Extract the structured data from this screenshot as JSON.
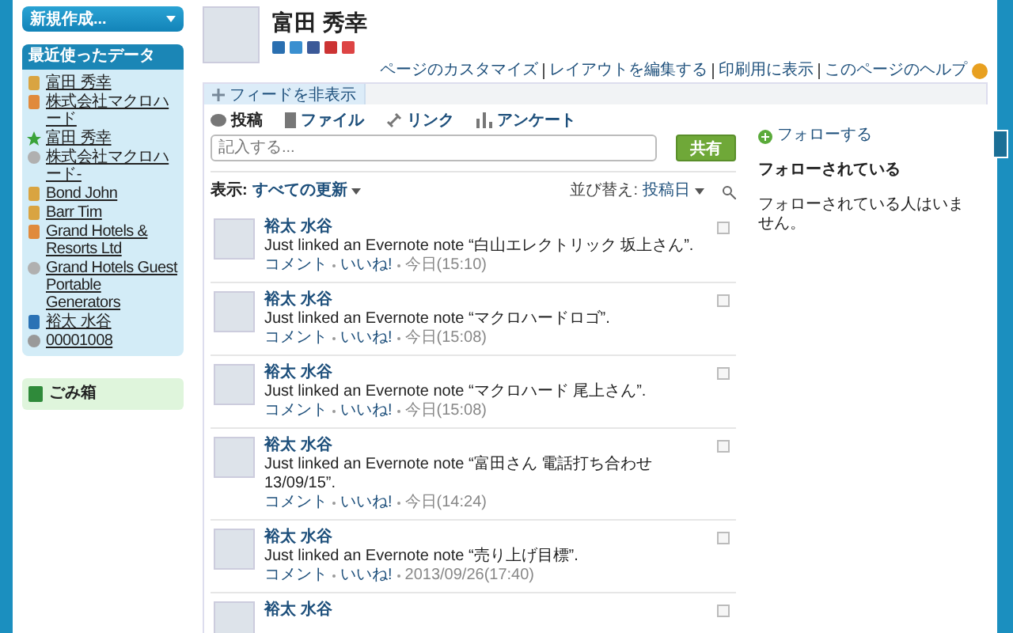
{
  "sidebar": {
    "create_button": "新規作成...",
    "recent": {
      "title": "最近使ったデータ",
      "items": [
        {
          "label": "富田 秀幸",
          "kind": "contact"
        },
        {
          "label": "株式会社マクロハード",
          "kind": "account"
        },
        {
          "label": "富田 秀幸",
          "kind": "lead"
        },
        {
          "label": "株式会社マクロハード-",
          "kind": "opportunity"
        },
        {
          "label": "Bond John",
          "kind": "contact"
        },
        {
          "label": "Barr Tim",
          "kind": "contact"
        },
        {
          "label": "Grand Hotels & Resorts Ltd",
          "kind": "account"
        },
        {
          "label": "Grand Hotels Guest Portable Generators",
          "kind": "opportunity"
        },
        {
          "label": "裕太 水谷",
          "kind": "user"
        },
        {
          "label": "00001008",
          "kind": "case"
        }
      ]
    },
    "trash": "ごみ箱"
  },
  "profile": {
    "name": "富田 秀幸"
  },
  "page_links": [
    "ページのカスタマイズ",
    "レイアウトを編集する",
    "印刷用に表示",
    "このページのヘルプ"
  ],
  "feed_toggle": "フィードを非表示",
  "publisher": {
    "tabs": [
      {
        "label": "投稿",
        "selected": true,
        "kind": "post"
      },
      {
        "label": "ファイル",
        "selected": false,
        "kind": "file"
      },
      {
        "label": "リンク",
        "selected": false,
        "kind": "link"
      },
      {
        "label": "アンケート",
        "selected": false,
        "kind": "poll"
      }
    ],
    "placeholder": "記入する...",
    "share_button": "共有"
  },
  "filter": {
    "label": "表示:",
    "value": "すべての更新",
    "sort_label": "並び替え:",
    "sort_value": "投稿日"
  },
  "feed": [
    {
      "author": "裕太 水谷",
      "text": "Just linked an Evernote note “白山エレクトリック 坂上さん”.",
      "comment": "コメント",
      "like": "いいね!",
      "time": "今日(15:10)"
    },
    {
      "author": "裕太 水谷",
      "text": "Just linked an Evernote note “マクロハードロゴ”.",
      "comment": "コメント",
      "like": "いいね!",
      "time": "今日(15:08)"
    },
    {
      "author": "裕太 水谷",
      "text": "Just linked an Evernote note “マクロハード 尾上さん”.",
      "comment": "コメント",
      "like": "いいね!",
      "time": "今日(15:08)"
    },
    {
      "author": "裕太 水谷",
      "text": "Just linked an Evernote note “富田さん 電話打ち合わせ 13/09/15”.",
      "comment": "コメント",
      "like": "いいね!",
      "time": "今日(14:24)"
    },
    {
      "author": "裕太 水谷",
      "text": "Just linked an Evernote note “売り上げ目標”.",
      "comment": "コメント",
      "like": "いいね!",
      "time": "2013/09/26(17:40)"
    },
    {
      "author": "裕太 水谷"
    }
  ],
  "follow": {
    "button": "フォローする",
    "title": "フォローされている",
    "empty": "フォローされている人はいません。"
  }
}
